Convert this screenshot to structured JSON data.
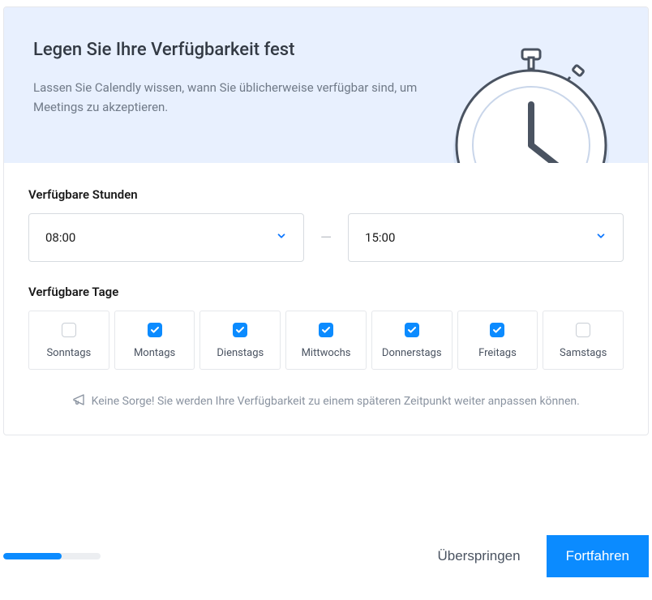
{
  "hero": {
    "title": "Legen Sie Ihre Verfügbarkeit fest",
    "subtitle": "Lassen Sie Calendly wissen, wann Sie üblicherweise verfügbar sind, um Meetings zu akzeptieren."
  },
  "hours": {
    "label": "Verfügbare Stunden",
    "start": "08:00",
    "end": "15:00",
    "separator": "—"
  },
  "days": {
    "label": "Verfügbare Tage",
    "items": [
      {
        "label": "Sonntags",
        "checked": false
      },
      {
        "label": "Montags",
        "checked": true
      },
      {
        "label": "Dienstags",
        "checked": true
      },
      {
        "label": "Mittwochs",
        "checked": true
      },
      {
        "label": "Donnerstags",
        "checked": true
      },
      {
        "label": "Freitags",
        "checked": true
      },
      {
        "label": "Samstags",
        "checked": false
      }
    ]
  },
  "hint": "Keine Sorge! Sie werden Ihre Verfügbarkeit zu einem späteren Zeitpunkt weiter anpassen können.",
  "footer": {
    "progress_percent": 60,
    "skip": "Überspringen",
    "continue": "Fortfahren"
  }
}
